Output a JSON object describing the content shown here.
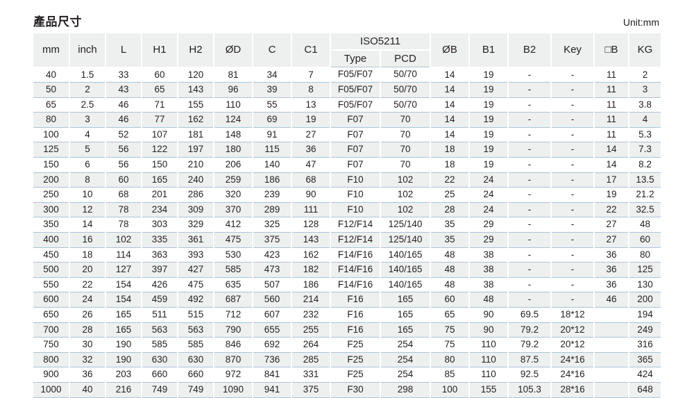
{
  "header": {
    "title": "產品尺寸",
    "unit": "Unit:mm"
  },
  "table": {
    "group_header": "ISO5211",
    "columns": [
      {
        "key": "mm",
        "label": "mm"
      },
      {
        "key": "inch",
        "label": "inch"
      },
      {
        "key": "L",
        "label": "L"
      },
      {
        "key": "H1",
        "label": "H1"
      },
      {
        "key": "H2",
        "label": "H2"
      },
      {
        "key": "OD",
        "label": "ØD"
      },
      {
        "key": "C",
        "label": "C"
      },
      {
        "key": "C1",
        "label": "C1"
      },
      {
        "key": "Type",
        "label": "Type"
      },
      {
        "key": "PCD",
        "label": "PCD"
      },
      {
        "key": "OB",
        "label": "ØB"
      },
      {
        "key": "B1",
        "label": "B1"
      },
      {
        "key": "B2",
        "label": "B2"
      },
      {
        "key": "Key",
        "label": "Key"
      },
      {
        "key": "sqB",
        "label": "□B"
      },
      {
        "key": "KG",
        "label": "KG"
      }
    ],
    "rows": [
      [
        "40",
        "1.5",
        "33",
        "60",
        "120",
        "81",
        "34",
        "7",
        "F05/F07",
        "50/70",
        "14",
        "19",
        "-",
        "-",
        "11",
        "2"
      ],
      [
        "50",
        "2",
        "43",
        "65",
        "143",
        "96",
        "39",
        "8",
        "F05/F07",
        "50/70",
        "14",
        "19",
        "-",
        "-",
        "11",
        "3"
      ],
      [
        "65",
        "2.5",
        "46",
        "71",
        "155",
        "110",
        "55",
        "13",
        "F05/F07",
        "50/70",
        "14",
        "19",
        "-",
        "-",
        "11",
        "3.8"
      ],
      [
        "80",
        "3",
        "46",
        "77",
        "162",
        "124",
        "69",
        "19",
        "F07",
        "70",
        "14",
        "19",
        "-",
        "-",
        "11",
        "4"
      ],
      [
        "100",
        "4",
        "52",
        "107",
        "181",
        "148",
        "91",
        "27",
        "F07",
        "70",
        "14",
        "19",
        "-",
        "-",
        "11",
        "5.3"
      ],
      [
        "125",
        "5",
        "56",
        "122",
        "197",
        "180",
        "115",
        "36",
        "F07",
        "70",
        "18",
        "19",
        "-",
        "-",
        "14",
        "7.3"
      ],
      [
        "150",
        "6",
        "56",
        "150",
        "210",
        "206",
        "140",
        "47",
        "F07",
        "70",
        "18",
        "19",
        "-",
        "-",
        "14",
        "8.2"
      ],
      [
        "200",
        "8",
        "60",
        "165",
        "240",
        "259",
        "186",
        "68",
        "F10",
        "102",
        "22",
        "24",
        "-",
        "-",
        "17",
        "13.5"
      ],
      [
        "250",
        "10",
        "68",
        "201",
        "286",
        "320",
        "239",
        "90",
        "F10",
        "102",
        "25",
        "24",
        "-",
        "-",
        "19",
        "21.2"
      ],
      [
        "300",
        "12",
        "78",
        "234",
        "309",
        "370",
        "289",
        "111",
        "F10",
        "102",
        "28",
        "24",
        "-",
        "-",
        "22",
        "32.5"
      ],
      [
        "350",
        "14",
        "78",
        "303",
        "329",
        "412",
        "325",
        "128",
        "F12/F14",
        "125/140",
        "35",
        "29",
        "-",
        "-",
        "27",
        "48"
      ],
      [
        "400",
        "16",
        "102",
        "335",
        "361",
        "475",
        "375",
        "143",
        "F12/F14",
        "125/140",
        "35",
        "29",
        "-",
        "-",
        "27",
        "60"
      ],
      [
        "450",
        "18",
        "114",
        "363",
        "393",
        "530",
        "423",
        "162",
        "F14/F16",
        "140/165",
        "48",
        "38",
        "-",
        "-",
        "36",
        "80"
      ],
      [
        "500",
        "20",
        "127",
        "397",
        "427",
        "585",
        "473",
        "182",
        "F14/F16",
        "140/165",
        "48",
        "38",
        "-",
        "-",
        "36",
        "125"
      ],
      [
        "550",
        "22",
        "154",
        "426",
        "475",
        "635",
        "507",
        "186",
        "F14/F16",
        "140/165",
        "48",
        "38",
        "-",
        "-",
        "36",
        "130"
      ],
      [
        "600",
        "24",
        "154",
        "459",
        "492",
        "687",
        "560",
        "214",
        "F16",
        "165",
        "60",
        "48",
        "-",
        "-",
        "46",
        "200"
      ],
      [
        "650",
        "26",
        "165",
        "511",
        "515",
        "712",
        "607",
        "232",
        "F16",
        "165",
        "65",
        "90",
        "69.5",
        "18*12",
        "",
        "194"
      ],
      [
        "700",
        "28",
        "165",
        "563",
        "563",
        "790",
        "655",
        "255",
        "F16",
        "165",
        "75",
        "90",
        "79.2",
        "20*12",
        "",
        "249"
      ],
      [
        "750",
        "30",
        "190",
        "585",
        "585",
        "846",
        "692",
        "264",
        "F25",
        "254",
        "75",
        "110",
        "79.2",
        "20*12",
        "",
        "316"
      ],
      [
        "800",
        "32",
        "190",
        "630",
        "630",
        "870",
        "736",
        "285",
        "F25",
        "254",
        "80",
        "110",
        "87.5",
        "24*16",
        "",
        "365"
      ],
      [
        "900",
        "36",
        "203",
        "660",
        "660",
        "972",
        "841",
        "331",
        "F25",
        "254",
        "85",
        "110",
        "92.5",
        "24*16",
        "",
        "424"
      ],
      [
        "1000",
        "40",
        "216",
        "749",
        "749",
        "1090",
        "941",
        "375",
        "F30",
        "298",
        "100",
        "155",
        "105.3",
        "28*16",
        "",
        "648"
      ]
    ]
  },
  "colors": {
    "header_bg": "#eeefef",
    "row_stripe": "#eeefef",
    "row_line": "#a9c4d9",
    "text": "#231f20"
  }
}
